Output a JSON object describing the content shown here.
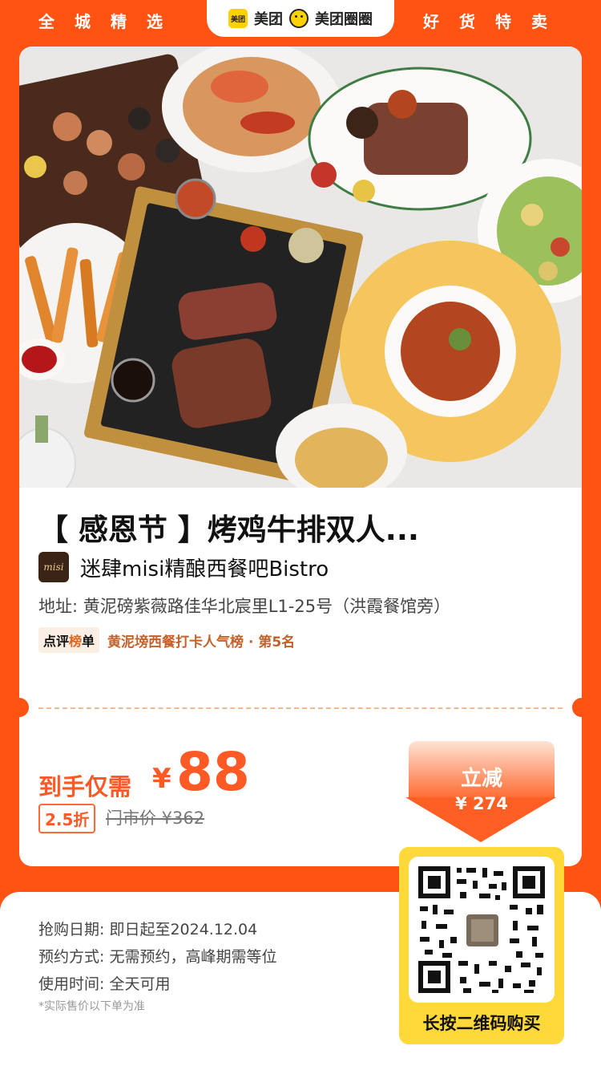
{
  "header": {
    "left_text": "全城精选",
    "right_text": "好货特卖",
    "brand_meituan_logo": "美团",
    "brand_meituan": "美团",
    "brand_quanquan": "美团圈圈"
  },
  "product": {
    "title": "【 感恩节 】烤鸡牛排双人...",
    "shop_logo_text": "misi",
    "shop_name": "迷肆misi精酿西餐吧Bistro",
    "address": "地址: 黄泥磅紫薇路佳华北宸里L1-25号（洪霞餐馆旁）",
    "rank_badge_a": "点评",
    "rank_badge_b": "榜",
    "rank_badge_c": "单",
    "rank_text": "黄泥塝西餐打卡人气榜 · 第5名"
  },
  "pricing": {
    "label": "到手仅需",
    "currency": "¥",
    "price": "88",
    "discount": "2.5折",
    "original": "门市价 ¥362",
    "save_label": "立减",
    "save_amount": "¥ 274"
  },
  "details": {
    "purchase_date": "抢购日期:  即日起至2024.12.04",
    "reservation": "预约方式:  无需预约，高峰期需等位",
    "usage_time": "使用时间:  全天可用",
    "note": "*实际售价以下单为准"
  },
  "qr": {
    "label": "长按二维码购买"
  },
  "colors": {
    "brand_orange": "#ff5314",
    "price_orange": "#ff5a26",
    "qr_yellow": "#ffd83a"
  }
}
